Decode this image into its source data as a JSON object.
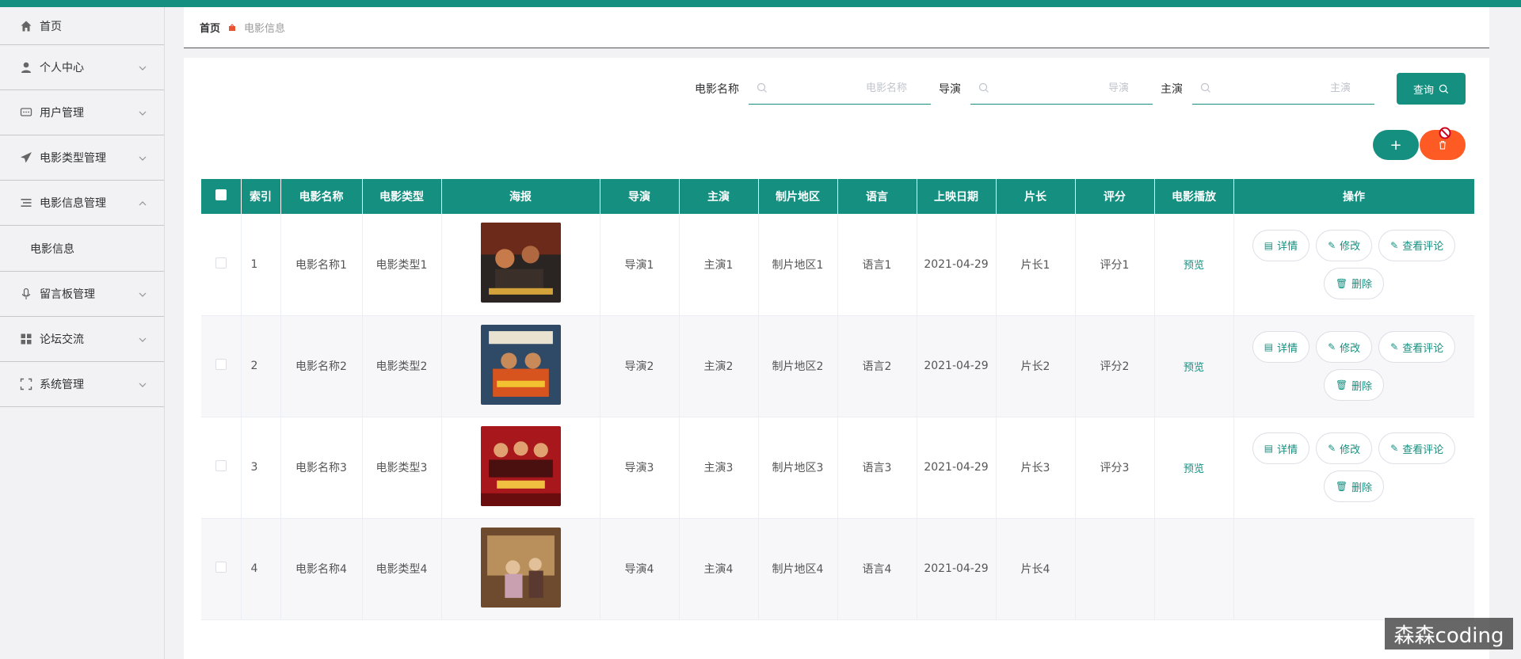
{
  "colors": {
    "accent": "#148f80",
    "danger": "#fe5a24"
  },
  "sidebar": {
    "items": [
      {
        "label": "首页",
        "icon": "home-icon"
      },
      {
        "label": "个人中心",
        "icon": "user-icon"
      },
      {
        "label": "用户管理",
        "icon": "chat-icon"
      },
      {
        "label": "电影类型管理",
        "icon": "paper-plane-icon"
      },
      {
        "label": "电影信息管理",
        "icon": "list-icon"
      },
      {
        "label": "电影信息",
        "icon": ""
      },
      {
        "label": "留言板管理",
        "icon": "microphone-icon"
      },
      {
        "label": "论坛交流",
        "icon": "grid-icon"
      },
      {
        "label": "系统管理",
        "icon": "fullscreen-icon"
      }
    ]
  },
  "breadcrumb": {
    "home": "首页",
    "current": "电影信息"
  },
  "search": {
    "name_label": "电影名称",
    "name_placeholder": "电影名称",
    "director_label": "导演",
    "director_placeholder": "导演",
    "actor_label": "主演",
    "actor_placeholder": "主演",
    "query_label": "查询"
  },
  "actions": {
    "add_label": "+",
    "delete_icon": "trash-icon"
  },
  "table": {
    "headers": [
      "索引",
      "电影名称",
      "电影类型",
      "海报",
      "导演",
      "主演",
      "制片地区",
      "语言",
      "上映日期",
      "片长",
      "评分",
      "电影播放",
      "操作"
    ],
    "rows": [
      {
        "index": "1",
        "name": "电影名称1",
        "type": "电影类型1",
        "director": "导演1",
        "actor": "主演1",
        "region": "制片地区1",
        "language": "语言1",
        "date": "2021-04-29",
        "length": "片长1",
        "rating": "评分1",
        "play": "预览"
      },
      {
        "index": "2",
        "name": "电影名称2",
        "type": "电影类型2",
        "director": "导演2",
        "actor": "主演2",
        "region": "制片地区2",
        "language": "语言2",
        "date": "2021-04-29",
        "length": "片长2",
        "rating": "评分2",
        "play": "预览"
      },
      {
        "index": "3",
        "name": "电影名称3",
        "type": "电影类型3",
        "director": "导演3",
        "actor": "主演3",
        "region": "制片地区3",
        "language": "语言3",
        "date": "2021-04-29",
        "length": "片长3",
        "rating": "评分3",
        "play": "预览"
      },
      {
        "index": "4",
        "name": "电影名称4",
        "type": "电影类型4",
        "director": "导演4",
        "actor": "主演4",
        "region": "制片地区4",
        "language": "语言4",
        "date": "2021-04-29",
        "length": "片长4",
        "rating": "",
        "play": ""
      }
    ],
    "ops": {
      "detail": "详情",
      "edit": "修改",
      "comments": "查看评论",
      "delete": "删除"
    }
  },
  "watermark": "森森coding"
}
